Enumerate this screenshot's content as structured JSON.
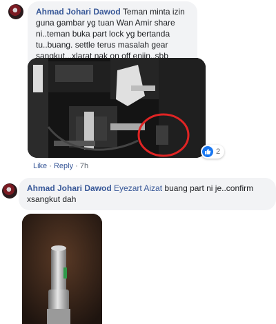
{
  "comments": [
    {
      "author": "Ahmad Johari Dawod",
      "text": "Teman minta izin guna gambar yg tuan Wan Amir share ni..teman buka part lock yg bertanda tu..buang. settle terus masalah gear sangkut...xlarat nak on off enjin..sbb kerap sgt kena lock...",
      "reaction_count": "2",
      "actions": {
        "like": "Like",
        "separator": "·",
        "reply": "Reply",
        "time": "7h"
      }
    },
    {
      "author": "Ahmad Johari Dawod",
      "tagged_user": "Eyezart Aizat",
      "text": "buang part ni je..confirm xsangkut dah"
    }
  ],
  "colors": {
    "name_link": "#385898",
    "bubble_bg": "#f2f3f5",
    "like_blue": "#1877f2",
    "annotation_red": "#e02424"
  }
}
